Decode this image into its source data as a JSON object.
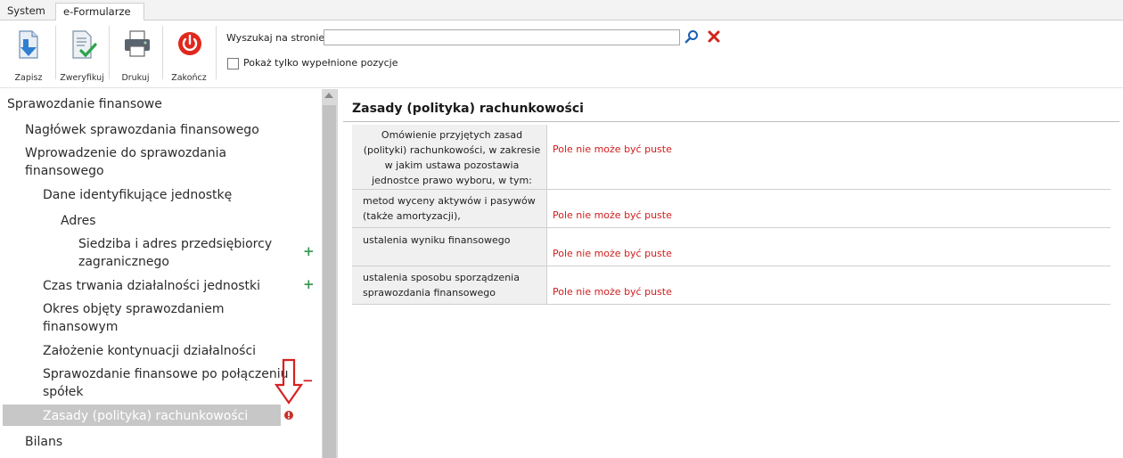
{
  "tabs": {
    "system": "System",
    "eforms": "e-Formularze"
  },
  "toolbar": {
    "save": "Zapisz",
    "verify": "Zweryfikuj",
    "print": "Drukuj",
    "finish": "Zakończ",
    "search_label": "Wyszukaj na stronie",
    "search_value": "",
    "filled_only_label": "Pokaż tylko wypełnione pozycje",
    "filled_only_checked": false
  },
  "tree": {
    "root": "Sprawozdanie finansowe",
    "items": [
      "Nagłówek sprawozdania finansowego",
      "Wprowadzenie do sprawozdania",
      "finansowego",
      "Dane identyfikujące jednostkę",
      "Adres",
      "Siedziba i adres przedsiębiorcy",
      "zagranicznego",
      "Czas trwania działalności jednostki",
      "Okres objęty sprawozdaniem",
      "finansowym",
      "Założenie kontynuacji działalności",
      "Sprawozdanie finansowe po połączeniu",
      "spółek",
      "Zasady (polityka) rachunkowości",
      "Bilans"
    ],
    "plus": "+",
    "minus": "−"
  },
  "section": {
    "title": "Zasady (polityka) rachunkowości",
    "rows": [
      {
        "label": "Omówienie przyjętych zasad (polityki) rachunkowości, w zakresie w jakim ustawa pozostawia jednostce prawo wyboru, w tym:",
        "value": "Pole nie może być puste"
      },
      {
        "label": "metod wyceny aktywów i pasywów (także amortyzacji),",
        "value": "Pole nie może być puste"
      },
      {
        "label": "ustalenia wyniku finansowego",
        "value": "Pole nie może być puste"
      },
      {
        "label": "ustalenia sposobu sporządzenia sprawozdania finansowego",
        "value": "Pole nie może być puste"
      }
    ]
  },
  "colors": {
    "error": "#d01c1c",
    "annotation_arrow": "#d62020",
    "selection": "#c7c7c7",
    "plus": "#3c9a55"
  },
  "icons": [
    "save-icon",
    "verify-icon",
    "print-icon",
    "power-icon",
    "search-icon",
    "close-icon",
    "error-icon",
    "arrow-down-annotation"
  ]
}
